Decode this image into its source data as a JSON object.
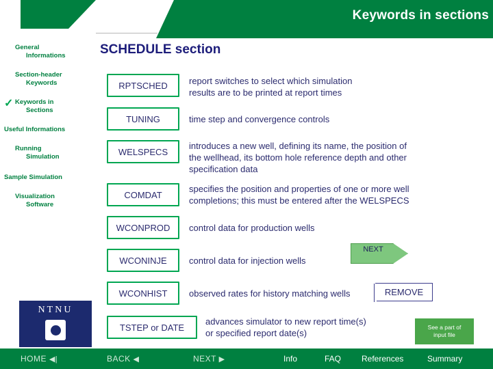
{
  "header": {
    "title": "Keywords in sections"
  },
  "slide": {
    "heading": "SCHEDULE section"
  },
  "sidebar": {
    "items": [
      {
        "line1": "General",
        "line2": "Informations",
        "checked": false
      },
      {
        "line1": "Section-header",
        "line2": "Keywords",
        "checked": false
      },
      {
        "line1": "Keywords in",
        "line2": "Sections",
        "checked": true
      },
      {
        "line1": "Useful Informations",
        "line2": "",
        "checked": false
      },
      {
        "line1": "Running",
        "line2": "Simulation",
        "checked": false
      },
      {
        "line1": "Sample Simulation",
        "line2": "",
        "checked": false
      },
      {
        "line1": "Visualization",
        "line2": "Software",
        "checked": false
      }
    ],
    "check_glyph": "✓",
    "logo_text": "NTNU"
  },
  "keywords": [
    {
      "name": "RPTSCHED",
      "desc": "report switches to select which simulation\nresults are to be printed at report times"
    },
    {
      "name": "TUNING",
      "desc": "time step and convergence controls"
    },
    {
      "name": "WELSPECS",
      "desc": "introduces a new well, defining its name, the position of\nthe wellhead, its bottom hole reference depth and other\nspecification data"
    },
    {
      "name": "COMDAT",
      "desc": "specifies the position and properties of one or more well\ncompletions; this must be entered after the WELSPECS"
    },
    {
      "name": "WCONPROD",
      "desc": "control data for production wells"
    },
    {
      "name": "WCONINJE",
      "desc": "control data for injection wells"
    },
    {
      "name": "WCONHIST",
      "desc": "observed rates for history matching wells"
    },
    {
      "name": "TSTEP or DATE",
      "desc": "advances simulator to new report time(s)\nor specified report date(s)"
    }
  ],
  "buttons": {
    "next_arrow": "NEXT",
    "remove": "REMOVE",
    "see_part": "See a part of\ninput file"
  },
  "footer": {
    "nav": [
      {
        "label": "HOME",
        "glyph": "◀|"
      },
      {
        "label": "BACK",
        "glyph": "◀"
      },
      {
        "label": "NEXT",
        "glyph": "▶"
      }
    ],
    "links": [
      "Info",
      "FAQ",
      "References",
      "Summary"
    ]
  },
  "colors": {
    "green": "#008040",
    "box_border": "#00a651",
    "text_blue": "#2b2b6e",
    "heading_blue": "#1c1c7a",
    "logo_blue": "#1c2a6e"
  }
}
